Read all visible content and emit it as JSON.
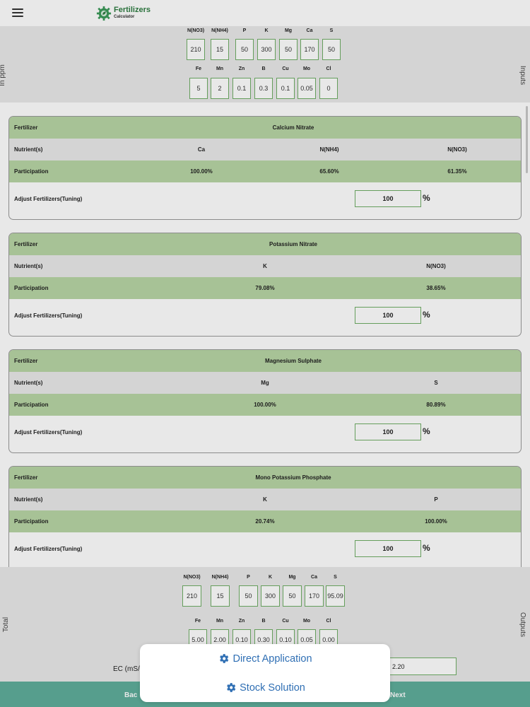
{
  "app": {
    "title": "Fertilizers",
    "subtitle": "Calculator"
  },
  "inputs": {
    "side_label_left": "In ppm",
    "side_label_right": "Inputs",
    "macro": [
      {
        "label": "N(NO3)",
        "value": "210"
      },
      {
        "label": "N(NH4)",
        "value": "15"
      },
      {
        "label": "P",
        "value": "50"
      },
      {
        "label": "K",
        "value": "300"
      },
      {
        "label": "Mg",
        "value": "50"
      },
      {
        "label": "Ca",
        "value": "170"
      },
      {
        "label": "S",
        "value": "50"
      }
    ],
    "micro": [
      {
        "label": "Fe",
        "value": "5"
      },
      {
        "label": "Mn",
        "value": "2"
      },
      {
        "label": "Zn",
        "value": "0.1"
      },
      {
        "label": "B",
        "value": "0.3"
      },
      {
        "label": "Cu",
        "value": "0.1"
      },
      {
        "label": "Mo",
        "value": "0.05"
      },
      {
        "label": "Cl",
        "value": "0"
      }
    ]
  },
  "labels": {
    "fertilizer": "Fertilizer",
    "nutrients": "Nutrient(s)",
    "participation": "Participation",
    "adjust": "Adjust Fertilizers(Tuning)",
    "percent": "%"
  },
  "fertilizers": [
    {
      "name": "Calcium Nitrate",
      "nutrients": [
        "Ca",
        "N(NH4)",
        "N(NO3)"
      ],
      "participation": [
        "100.00%",
        "65.60%",
        "61.35%"
      ],
      "tuning": "100"
    },
    {
      "name": "Potassium Nitrate",
      "nutrients": [
        "K",
        "N(NO3)"
      ],
      "participation": [
        "79.08%",
        "38.65%"
      ],
      "tuning": "100"
    },
    {
      "name": "Magnesium Sulphate",
      "nutrients": [
        "Mg",
        "S"
      ],
      "participation": [
        "100.00%",
        "80.89%"
      ],
      "tuning": "100"
    },
    {
      "name": "Mono Potassium Phosphate",
      "nutrients": [
        "K",
        "P"
      ],
      "participation": [
        "20.74%",
        "100.00%"
      ],
      "tuning": "100"
    }
  ],
  "outputs": {
    "side_label_left": "Total",
    "side_label_right": "Outputs",
    "macro": [
      {
        "label": "N(NO3)",
        "value": "210"
      },
      {
        "label": "N(NH4)",
        "value": "15"
      },
      {
        "label": "P",
        "value": "50"
      },
      {
        "label": "K",
        "value": "300"
      },
      {
        "label": "Mg",
        "value": "50"
      },
      {
        "label": "Ca",
        "value": "170"
      },
      {
        "label": "S",
        "value": "95.09"
      }
    ],
    "micro": [
      {
        "label": "Fe",
        "value": "5.00"
      },
      {
        "label": "Mn",
        "value": "2.00"
      },
      {
        "label": "Zn",
        "value": "0.10"
      },
      {
        "label": "B",
        "value": "0.30"
      },
      {
        "label": "Cu",
        "value": "0.10"
      },
      {
        "label": "Mo",
        "value": "0.05"
      },
      {
        "label": "Cl",
        "value": "0.00"
      }
    ],
    "ec_label": "EC (mS/c",
    "ec_value": "2.20"
  },
  "navigation": {
    "back": "Bac",
    "next": "Next"
  },
  "action_sheet": {
    "direct": "Direct Application",
    "stock": "Stock Solution"
  },
  "colors": {
    "accent_green": "#6fae66",
    "row_green": "#b8d6a5",
    "bottom_bar": "#5fae9c",
    "action_text": "#2f6fb4"
  }
}
